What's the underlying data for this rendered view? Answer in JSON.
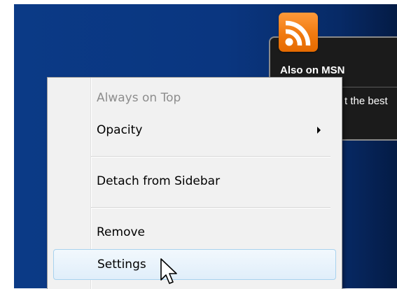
{
  "gadget": {
    "title": "Also on MSN",
    "snippet": "t the best",
    "icon": "rss-feed-icon"
  },
  "context_menu": {
    "items": [
      {
        "label": "Always on Top",
        "disabled": true
      },
      {
        "label": "Opacity",
        "has_submenu": true
      },
      {
        "label": "Detach from Sidebar"
      },
      {
        "label": "Remove"
      },
      {
        "label": "Settings",
        "highlighted": true
      }
    ]
  },
  "cursor": "arrow-pointer-icon",
  "colors": {
    "desktop": "#0a3680",
    "rss_orange": "#f07a10",
    "menu_background": "#f1f1f1",
    "highlight_border": "#a8d2ee",
    "disabled_text": "#8d8d8d"
  }
}
